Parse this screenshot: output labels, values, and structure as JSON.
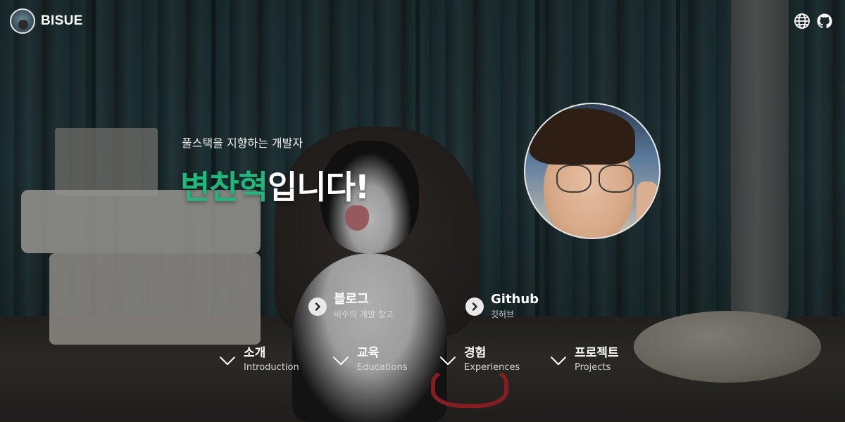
{
  "header": {
    "brand_name": "BISUE",
    "icons": [
      "language-globe-icon",
      "github-icon"
    ]
  },
  "hero": {
    "subtitle": "풀스택을 지향하는 개발자",
    "name": "변찬혁",
    "suffix": "입니다!",
    "accent_color": "#1fb87c"
  },
  "links": [
    {
      "title": "블로그",
      "subtitle": "비수의 개발 창고",
      "icon": "chevron-right-circle-icon"
    },
    {
      "title": "Github",
      "subtitle": "깃허브",
      "icon": "chevron-right-circle-icon"
    }
  ],
  "sections": [
    {
      "ko": "소개",
      "en": "Introduction",
      "icon": "chevron-down-icon"
    },
    {
      "ko": "교육",
      "en": "Educations",
      "icon": "chevron-down-icon"
    },
    {
      "ko": "경험",
      "en": "Experiences",
      "icon": "chevron-down-icon"
    },
    {
      "ko": "프로젝트",
      "en": "Projects",
      "icon": "chevron-down-icon"
    }
  ]
}
